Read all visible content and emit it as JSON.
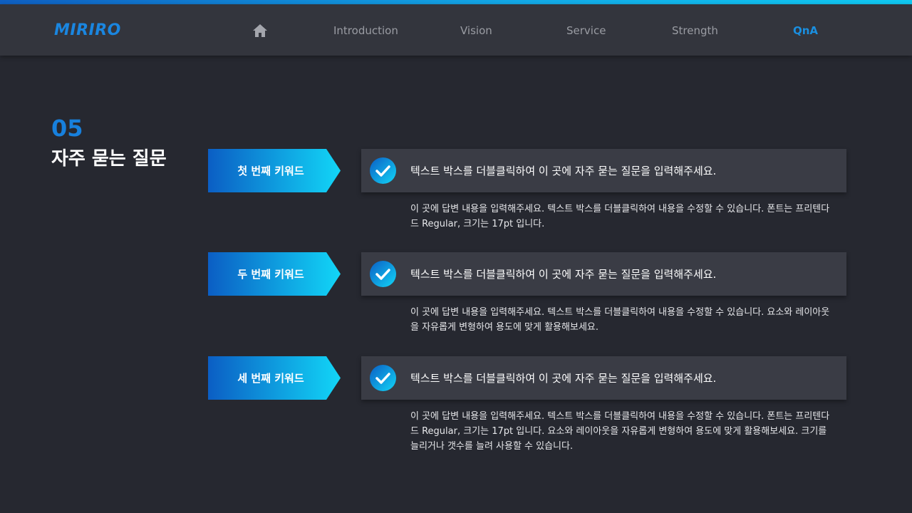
{
  "header": {
    "logo": "MIRIRO",
    "nav": {
      "home_icon": "home-icon",
      "items": [
        "Introduction",
        "Vision",
        "Service",
        "Strength",
        "QnA"
      ],
      "active": "QnA"
    }
  },
  "section": {
    "number": "05",
    "title": "자주 묻는 질문"
  },
  "faqs": [
    {
      "keyword": "첫 번째 키워드",
      "question": "텍스트 박스를 더블클릭하여 이 곳에 자주 묻는 질문을 입력해주세요.",
      "answer": "이 곳에 답변 내용을 입력해주세요. 텍스트 박스를 더블클릭하여 내용을 수정할 수 있습니다. 폰트는 프리텐다드 Regular, 크기는 17pt 입니다."
    },
    {
      "keyword": "두 번째 키워드",
      "question": "텍스트 박스를 더블클릭하여 이 곳에 자주 묻는 질문을 입력해주세요.",
      "answer": "이 곳에 답변 내용을 입력해주세요. 텍스트 박스를 더블클릭하여 내용을 수정할 수 있습니다. 요소와 레이아웃을 자유롭게 변형하여 용도에 맞게 활용해보세요."
    },
    {
      "keyword": "세 번째 키워드",
      "question": "텍스트 박스를 더블클릭하여 이 곳에 자주 묻는 질문을 입력해주세요.",
      "answer": "이 곳에 답변 내용을 입력해주세요. 텍스트 박스를 더블클릭하여 내용을 수정할 수 있습니다. 폰트는 프리텐다드 Regular, 크기는 17pt 입니다. 요소와 레이아웃을 자유롭게 변형하여 용도에 맞게 활용해보세요. 크기를 늘리거나 갯수를 늘려 사용할 수 있습니다."
    }
  ],
  "colors": {
    "accent": "#1a8fe0",
    "background": "#262830",
    "header": "#33353d",
    "question_box": "#3a3c45"
  }
}
